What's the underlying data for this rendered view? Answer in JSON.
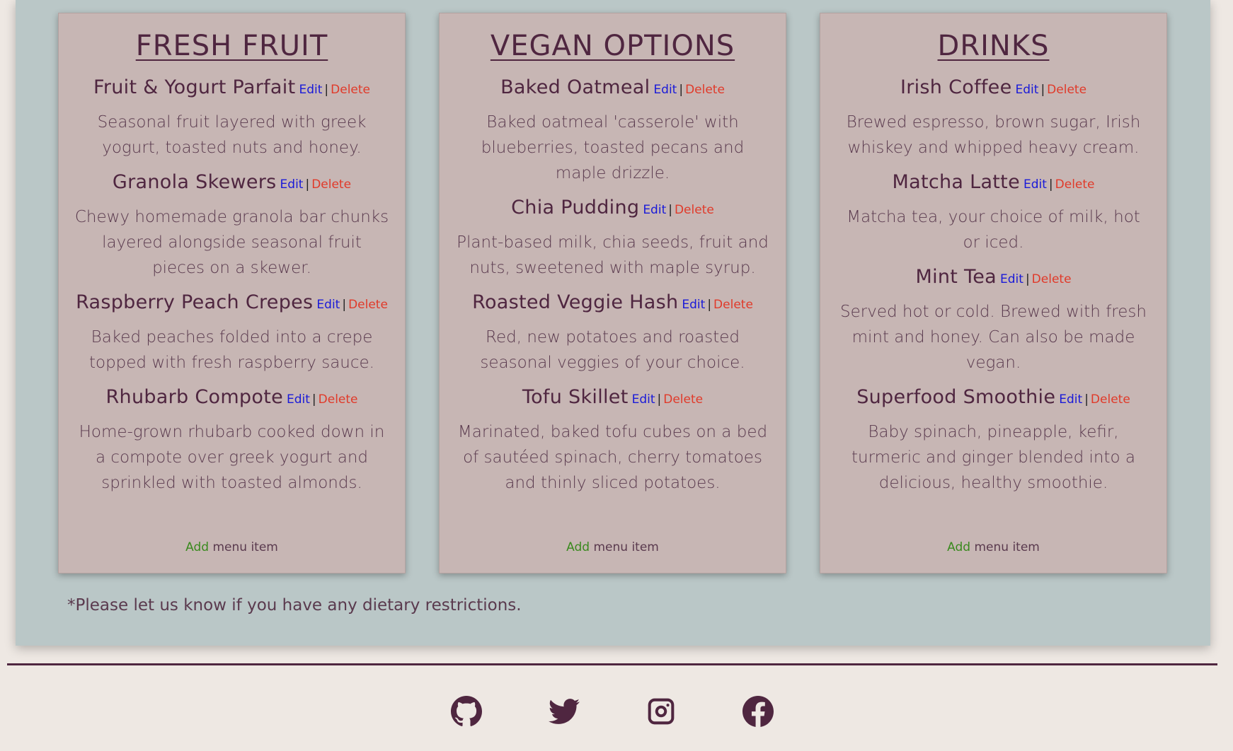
{
  "columns": [
    {
      "title": "FRESH FRUIT",
      "items": [
        {
          "name": "Fruit & Yogurt Parfait",
          "description": "Seasonal fruit layered with greek yogurt, toasted nuts and honey."
        },
        {
          "name": "Granola Skewers",
          "description": "Chewy homemade granola bar chunks layered alongside seasonal fruit pieces on a skewer."
        },
        {
          "name": "Raspberry Peach Crepes",
          "description": "Baked peaches folded into a crepe topped with fresh raspberry sauce."
        },
        {
          "name": "Rhubarb Compote",
          "description": "Home-grown rhubarb cooked down in a compote over greek yogurt and sprinkled with toasted almonds."
        }
      ]
    },
    {
      "title": "VEGAN OPTIONS",
      "items": [
        {
          "name": "Baked Oatmeal",
          "description": "Baked oatmeal 'casserole' with blueberries, toasted pecans and maple drizzle."
        },
        {
          "name": "Chia Pudding",
          "description": "Plant-based milk, chia seeds, fruit and nuts, sweetened with maple syrup."
        },
        {
          "name": "Roasted Veggie Hash",
          "description": "Red, new potatoes and roasted seasonal veggies of your choice."
        },
        {
          "name": "Tofu Skillet",
          "description": "Marinated, baked tofu cubes on a bed of sautéed spinach, cherry tomatoes and thinly sliced potatoes."
        }
      ]
    },
    {
      "title": "DRINKS",
      "items": [
        {
          "name": "Irish Coffee",
          "description": "Brewed espresso, brown sugar, Irish whiskey and whipped heavy cream."
        },
        {
          "name": "Matcha Latte",
          "description": "Matcha tea, your choice of milk, hot or iced."
        },
        {
          "name": "Mint Tea",
          "description": "Served hot or cold. Brewed with fresh mint and honey. Can also be made vegan."
        },
        {
          "name": "Superfood Smoothie",
          "description": "Baby spinach, pineapple, kefir, turmeric and ginger blended into a delicious, healthy smoothie."
        }
      ]
    }
  ],
  "actions": {
    "edit_label": "Edit",
    "separator": "|",
    "delete_label": "Delete",
    "add_label": "Add",
    "add_suffix": " menu item"
  },
  "footer_note": "*Please let us know if you have any dietary restrictions.",
  "social_icons": [
    "github-icon",
    "twitter-icon",
    "instagram-icon",
    "facebook-icon"
  ],
  "colors": {
    "text": "#4f2640",
    "panel_bg": "#bac7c7",
    "card_bg": "#c7b6b4",
    "page_bg": "#eee8e3",
    "edit": "#1a1ad8",
    "delete": "#e03a2a",
    "add": "#3a8a1e"
  }
}
